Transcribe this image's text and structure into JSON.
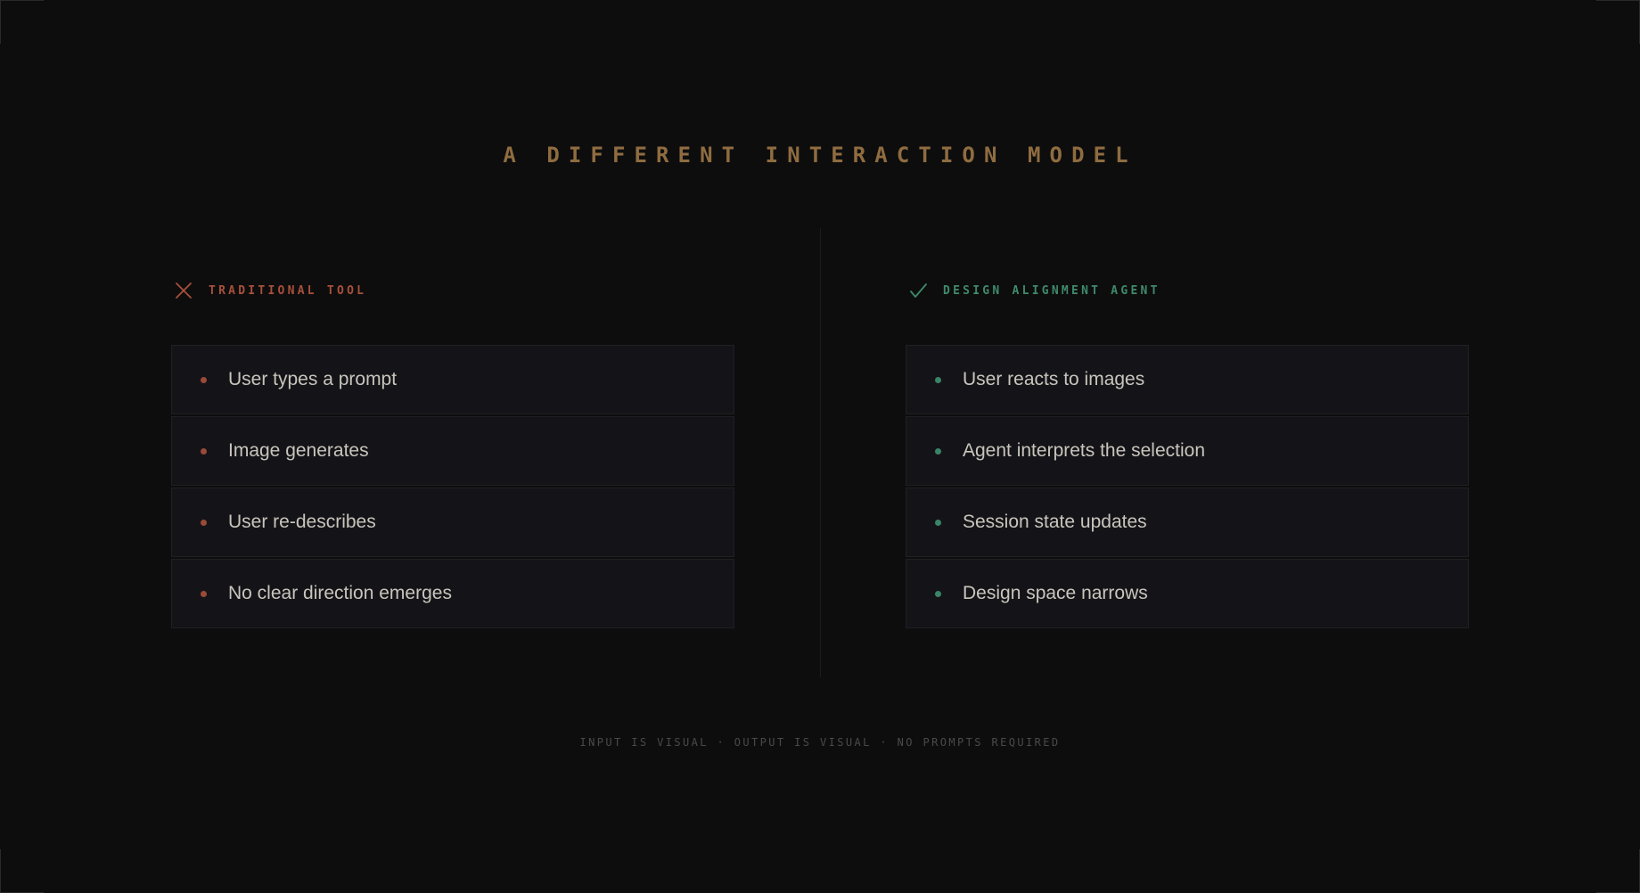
{
  "title": "A DIFFERENT INTERACTION MODEL",
  "colors": {
    "background": "#0d0d0d",
    "title": "#8f6c40",
    "traditional_accent": "#a8503c",
    "agent_accent": "#3f8a6c",
    "card_background": "#141418",
    "item_text": "#c9c5bd",
    "footer_text": "#4a4a4a"
  },
  "traditional": {
    "icon": "x-icon",
    "label": "TRADITIONAL TOOL",
    "items": [
      {
        "text": "User types a prompt"
      },
      {
        "text": "Image generates"
      },
      {
        "text": "User re-describes"
      },
      {
        "text": "No clear direction emerges"
      }
    ]
  },
  "agent": {
    "icon": "check-icon",
    "label": "DESIGN ALIGNMENT AGENT",
    "items": [
      {
        "text": "User reacts to images"
      },
      {
        "text": "Agent interprets the selection"
      },
      {
        "text": "Session state updates"
      },
      {
        "text": "Design space narrows"
      }
    ]
  },
  "footer": "INPUT IS VISUAL · OUTPUT IS VISUAL · NO PROMPTS REQUIRED"
}
